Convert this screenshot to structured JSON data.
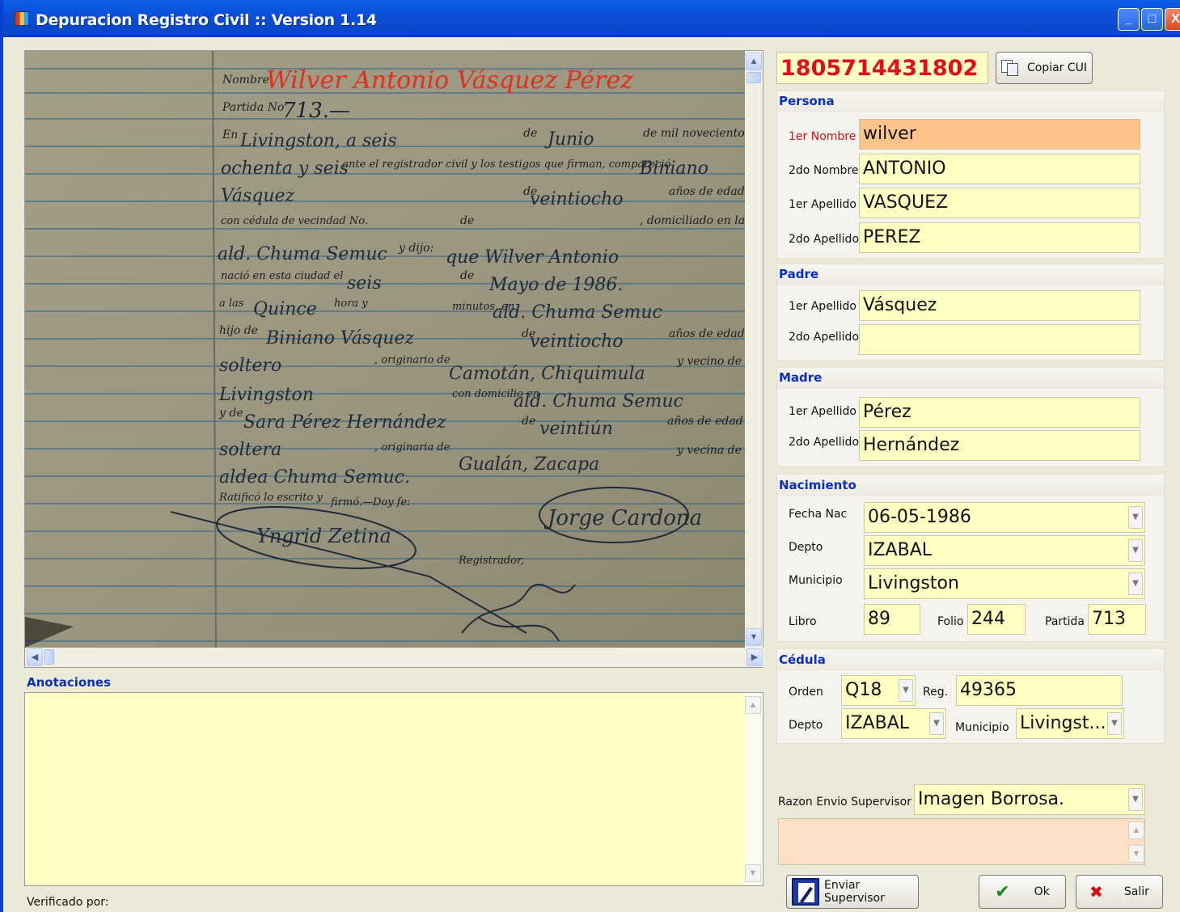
{
  "window": {
    "title": "Depuracion Registro Civil :: Version 1.14",
    "minimize": "_",
    "maximize": "□",
    "close": "X"
  },
  "document": {
    "printed": {
      "nombre": "Nombre",
      "partida": "Partida No",
      "en": "En",
      "de1": "de",
      "de_mil": "de mil novecientos",
      "ante": ", ante el registrador civil y los testigos que firman, compareció",
      "de2": "de",
      "anos1": "años de edad",
      "cedula": "con cédula de vecindad No.",
      "de3": "de",
      "domiciliado": ", domiciliado en la",
      "ydijo": "y dijo:",
      "nacio": "nació en esta ciudad el",
      "de4": "de",
      "alas": "a las",
      "hora": "hora y",
      "minutos": "minutos, en",
      "hijo": "hijo de",
      "de5": "de",
      "anos2": "años de edad",
      "originario": ", originario de",
      "vecino": "y vecino de",
      "domicilio": "con domicilio en",
      "yde": "y de",
      "de6": "de",
      "anos3": "años de edad",
      "originaria": ", originaria de",
      "vecina": "y vecina de",
      "ratifico": "Ratificó lo escrito y",
      "firmo": "firmó.—Doy fe:",
      "registrador": "Registrador,"
    },
    "handwritten": {
      "nombre": "Wilver Antonio Vásquez Pérez",
      "partida": "713.—",
      "dia": "Livingston, a seis",
      "mes": "Junio",
      "anio": "ochenta y seis",
      "compareciente": "Biniano",
      "apellido": "Vásquez",
      "edad": "veintiocho",
      "lugar": "ald. Chuma Semuc",
      "nacimiento": "que Wilver Antonio",
      "dia_nac": "seis",
      "fecha_nac": "Mayo de 1986.",
      "hora": "Quince",
      "lugar2": "ald. Chuma Semuc",
      "padre": "Biniano Vásquez",
      "padre_edad": "veintiocho",
      "estado": "soltero",
      "origen": "Camotán, Chiquimula",
      "ciudad": "Livingston",
      "domicilio": "ald. Chuma Semuc",
      "madre": "Sara Pérez Hernández",
      "madre_edad": "veintiún",
      "estado2": "soltera",
      "origen2": "Gualán, Zacapa",
      "aldea": "aldea Chuma Semuc.",
      "firma1": "Yngrid Zetina",
      "firma2": "Jorge Cardona"
    }
  },
  "anotaciones": {
    "label": "Anotaciones",
    "value": ""
  },
  "verificado": {
    "label": "Verificado por:"
  },
  "cui": {
    "value": "1805714431802",
    "copy_label": "Copiar CUI"
  },
  "persona": {
    "title": "Persona",
    "primer_nombre": {
      "label": "1er Nombre",
      "value": "wilver"
    },
    "segundo_nombre": {
      "label": "2do Nombre",
      "value": "ANTONIO"
    },
    "primer_apellido": {
      "label": "1er Apellido",
      "value": "VASQUEZ"
    },
    "segundo_apellido": {
      "label": "2do Apellido",
      "value": "PEREZ"
    }
  },
  "padre": {
    "title": "Padre",
    "primer_apellido": {
      "label": "1er Apellido",
      "value": "Vásquez"
    },
    "segundo_apellido": {
      "label": "2do Apellido",
      "value": ""
    }
  },
  "madre": {
    "title": "Madre",
    "primer_apellido": {
      "label": "1er Apellido",
      "value": "Pérez"
    },
    "segundo_apellido": {
      "label": "2do Apellido",
      "value": "Hernández"
    }
  },
  "nacimiento": {
    "title": "Nacimiento",
    "fecha": {
      "label": "Fecha Nac",
      "value": "06-05-1986"
    },
    "depto": {
      "label": "Depto",
      "value": "IZABAL"
    },
    "municipio": {
      "label": "Municipio",
      "value": "Livingston"
    },
    "libro": {
      "label": "Libro",
      "value": "89"
    },
    "folio": {
      "label": "Folio",
      "value": "244"
    },
    "partida": {
      "label": "Partida",
      "value": "713"
    }
  },
  "cedula": {
    "title": "Cédula",
    "orden": {
      "label": "Orden",
      "value": "Q18"
    },
    "reg": {
      "label": "Reg.",
      "value": "49365"
    },
    "depto": {
      "label": "Depto",
      "value": "IZABAL"
    },
    "municipio": {
      "label": "Municipio",
      "value": "Livingst..."
    }
  },
  "razon": {
    "label": "Razon Envio Supervisor",
    "value": "Imagen Borrosa.",
    "text": ""
  },
  "buttons": {
    "enviar": "Enviar Supervisor",
    "ok": "Ok",
    "salir": "Salir"
  },
  "icons": {
    "copy": "copy-icon",
    "check": "✔",
    "x": "✖",
    "arrow_down": "▼",
    "arrow_up": "▲",
    "arrow_left": "◀",
    "arrow_right": "▶"
  },
  "colors": {
    "accent": "#0b2fbf",
    "cui": "#e0101a",
    "field": "#ffffc4",
    "active_field": "#fcc48b"
  }
}
